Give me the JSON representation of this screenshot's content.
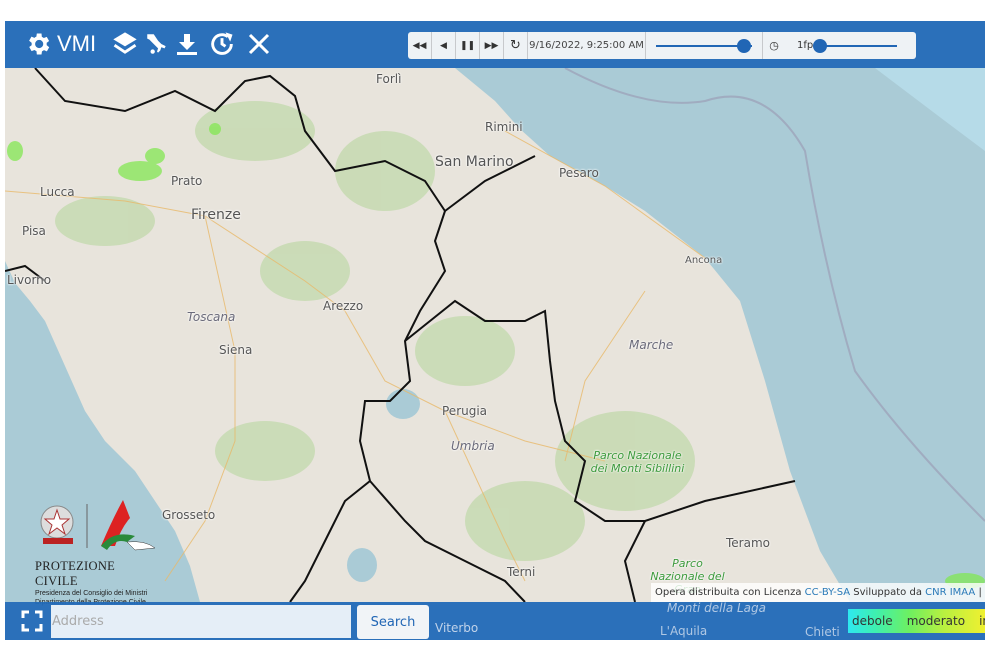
{
  "header": {
    "title": "VMI",
    "icons": [
      "gear-icon",
      "layers-icon",
      "italy-icon",
      "download-icon",
      "history-icon",
      "close-icon"
    ]
  },
  "player": {
    "buttons": [
      "fast-backward-icon",
      "step-backward-icon",
      "pause-icon",
      "step-forward-icon",
      "refresh-icon"
    ],
    "datetime": "9/16/2022, 9:25:00 AM",
    "time_position": 0.92,
    "speed_label": "1fps",
    "speed_position": 0.02
  },
  "map": {
    "labels": {
      "forli": "Forlì",
      "rimini": "Rimini",
      "san_marino": "San Marino",
      "pesaro": "Pesaro",
      "lucca": "Lucca",
      "prato": "Prato",
      "firenze": "Firenze",
      "pisa": "Pisa",
      "livorno": "Livorno",
      "arezzo": "Arezzo",
      "toscana": "Toscana",
      "siena": "Siena",
      "ancona": "Ancona",
      "marche": "Marche",
      "perugia": "Perugia",
      "umbria": "Umbria",
      "grosseto": "Grosseto",
      "sibillini": "Parco Nazionale dei Monti Sibillini",
      "teramo": "Teramo",
      "terni": "Terni",
      "gran_sasso": "Parco Nazionale del Gran",
      "laga": "Monti della Laga",
      "aquila": "L'Aquila",
      "chieti": "Chieti",
      "viterbo": "Viterbo"
    },
    "colors": {
      "land": "#e8e4dc",
      "sea": "#aacbd6",
      "border": "#111111",
      "radar": "#7de84a"
    }
  },
  "logo": {
    "name": "PROTEZIONE CIVILE",
    "line1": "Presidenza del Consiglio dei Ministri",
    "line2": "Dipartimento della Protezione Civile"
  },
  "attribution": {
    "prefix": "Opera distribuita con Licenza ",
    "license": "CC-BY-SA",
    "middle": " Sviluppato da ",
    "developer": "CNR IMAA",
    "suffix": " | OpenStreetMap"
  },
  "search": {
    "placeholder": "Address",
    "button": "Search"
  },
  "legend": {
    "items": [
      "debole",
      "moderato",
      "intenso"
    ]
  },
  "colors": {
    "bar": "#2169b7"
  }
}
